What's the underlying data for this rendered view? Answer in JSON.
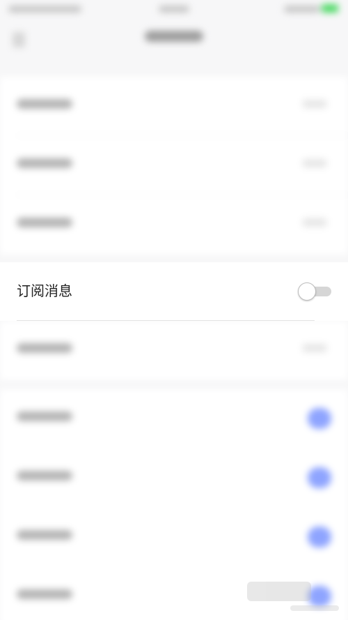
{
  "subscription": {
    "label": "订阅消息",
    "toggle_on": false
  }
}
